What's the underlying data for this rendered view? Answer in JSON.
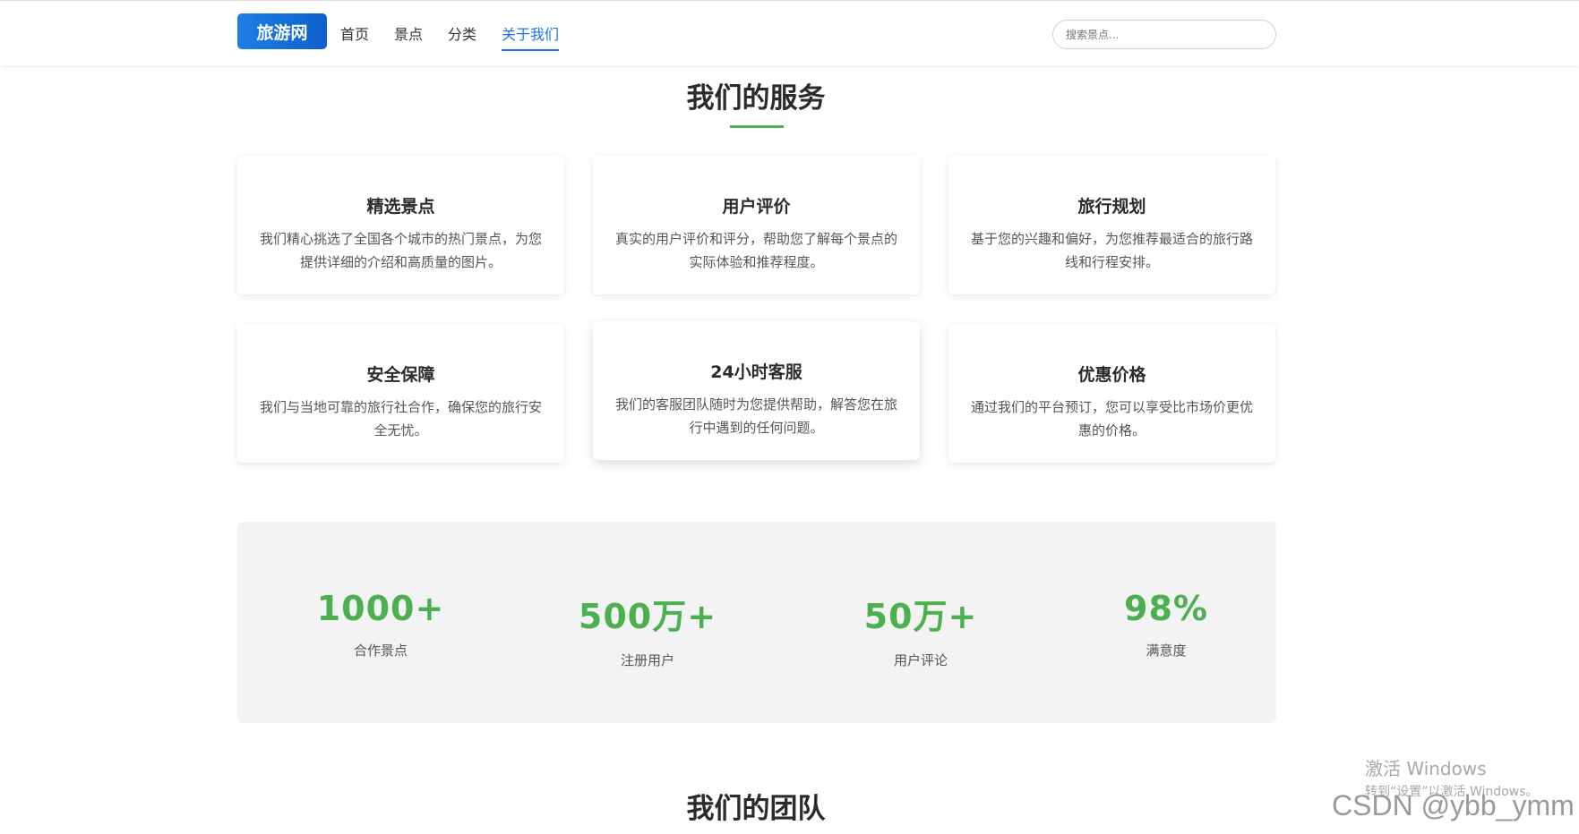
{
  "header": {
    "logo_text": "旅游网",
    "nav": [
      {
        "label": "首页",
        "active": false
      },
      {
        "label": "景点",
        "active": false
      },
      {
        "label": "分类",
        "active": false
      },
      {
        "label": "关于我们",
        "active": true
      }
    ],
    "search_placeholder": "搜索景点..."
  },
  "services": {
    "title": "我们的服务",
    "accent_color": "#4caf50",
    "cards": [
      {
        "title": "精选景点",
        "desc": "我们精心挑选了全国各个城市的热门景点，为您提供详细的介绍和高质量的图片。"
      },
      {
        "title": "用户评价",
        "desc": "真实的用户评价和评分，帮助您了解每个景点的实际体验和推荐程度。"
      },
      {
        "title": "旅行规划",
        "desc": "基于您的兴趣和偏好，为您推荐最适合的旅行路线和行程安排。"
      },
      {
        "title": "安全保障",
        "desc": "我们与当地可靠的旅行社合作，确保您的旅行安全无忧。"
      },
      {
        "title": "24小时客服",
        "desc": "我们的客服团队随时为您提供帮助，解答您在旅行中遇到的任何问题。"
      },
      {
        "title": "优惠价格",
        "desc": "通过我们的平台预订，您可以享受比市场价更优惠的价格。"
      }
    ]
  },
  "stats": [
    {
      "value": "1000+",
      "label": "合作景点"
    },
    {
      "value": "500万+",
      "label": "注册用户"
    },
    {
      "value": "50万+",
      "label": "用户评论"
    },
    {
      "value": "98%",
      "label": "满意度"
    }
  ],
  "team": {
    "title": "我们的团队"
  },
  "watermarks": {
    "windows_line1": "激活 Windows",
    "windows_line2": "转到“设置”以激活 Windows。",
    "csdn": "CSDN @ybb_ymm"
  }
}
